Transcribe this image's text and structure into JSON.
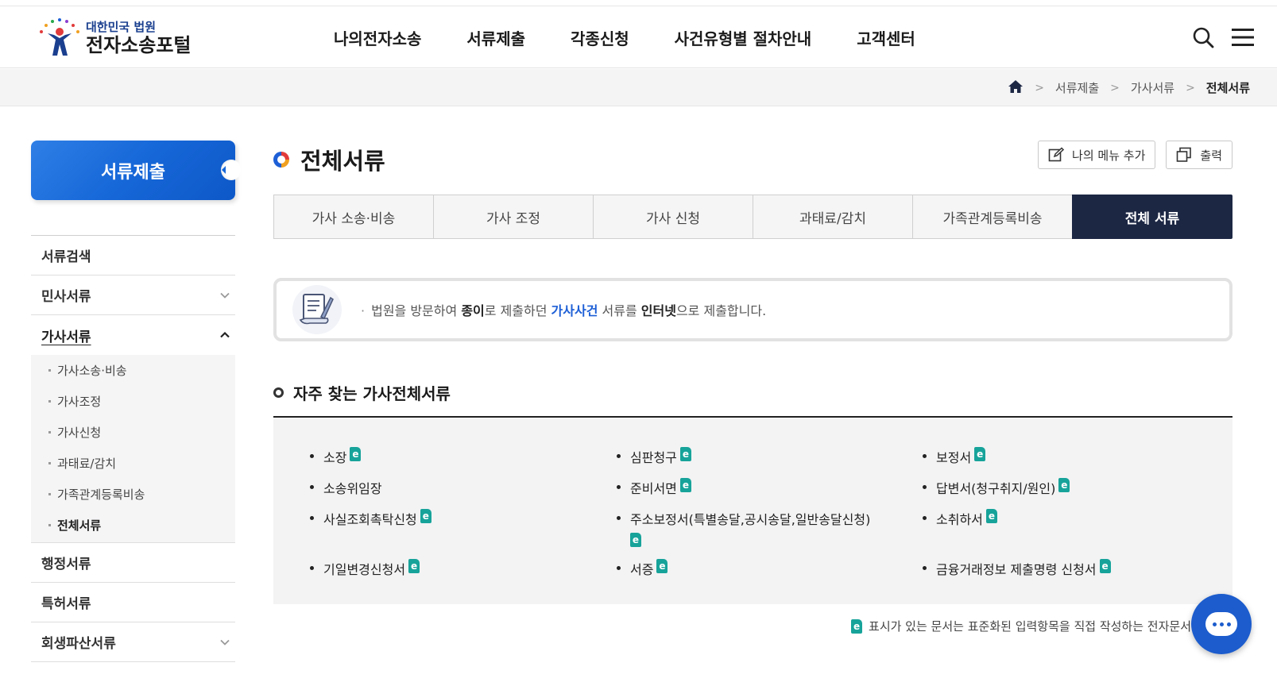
{
  "header": {
    "logo_small": "대한민국 법원",
    "logo_big": "전자소송포털",
    "gnb": [
      "나의전자소송",
      "서류제출",
      "각종신청",
      "사건유형별 절차안내",
      "고객센터"
    ],
    "search_icon": "search-icon",
    "menu_icon": "hamburger-menu-icon"
  },
  "breadcrumb": {
    "home_icon": "home-icon",
    "items": [
      "서류제출",
      "가사서류",
      "전체서류"
    ]
  },
  "sidebar": {
    "title": "서류제출",
    "items": [
      {
        "label": "서류검색"
      },
      {
        "label": "민사서류"
      },
      {
        "label": "가사서류"
      },
      {
        "label": "행정서류"
      },
      {
        "label": "특허서류"
      },
      {
        "label": "회생파산서류"
      }
    ],
    "sub_items": [
      "가사소송·비송",
      "가사조정",
      "가사신청",
      "과태료/감치",
      "가족관계등록비송",
      "전체서류"
    ]
  },
  "page": {
    "title": "전체서류",
    "add_menu_label": "나의 메뉴 추가",
    "print_label": "출력"
  },
  "tabs": [
    "가사 소송·비송",
    "가사 조정",
    "가사 신청",
    "과태료/감치",
    "가족관계등록비송",
    "전체 서류"
  ],
  "notice": {
    "p1": "법원을 방문하여 ",
    "b1": "종이",
    "p2": "로 제출하던 ",
    "hl": "가사사건",
    "p3": " 서류를 ",
    "b2": "인터넷",
    "p4": "으로 제출합니다."
  },
  "section": {
    "title": "자주 찾는 가사전체서류",
    "docs": [
      {
        "label": "소장",
        "e": true
      },
      {
        "label": "심판청구",
        "e": true
      },
      {
        "label": "보정서",
        "e": true
      },
      {
        "label": "소송위임장",
        "e": false
      },
      {
        "label": "준비서면",
        "e": true
      },
      {
        "label": "답변서(청구취지/원인)",
        "e": true
      },
      {
        "label": "사실조회촉탁신청",
        "e": true
      },
      {
        "label": "주소보정서(특별송달,공시송달,일반송달신청)",
        "e": true
      },
      {
        "label": "소취하서",
        "e": true
      },
      {
        "label": "기일변경신청서",
        "e": true
      },
      {
        "label": "서증",
        "e": true
      },
      {
        "label": "금융거래정보 제출명령 신청서",
        "e": true
      }
    ],
    "e_letter": "e"
  },
  "footnote": "표시가 있는 문서는 표준화된 입력항목을 직접 작성하는 전자문서",
  "colors": {
    "brand_blue": "#1667d8",
    "tab_selected": "#1c2744",
    "e_icon": "#17a39a"
  }
}
